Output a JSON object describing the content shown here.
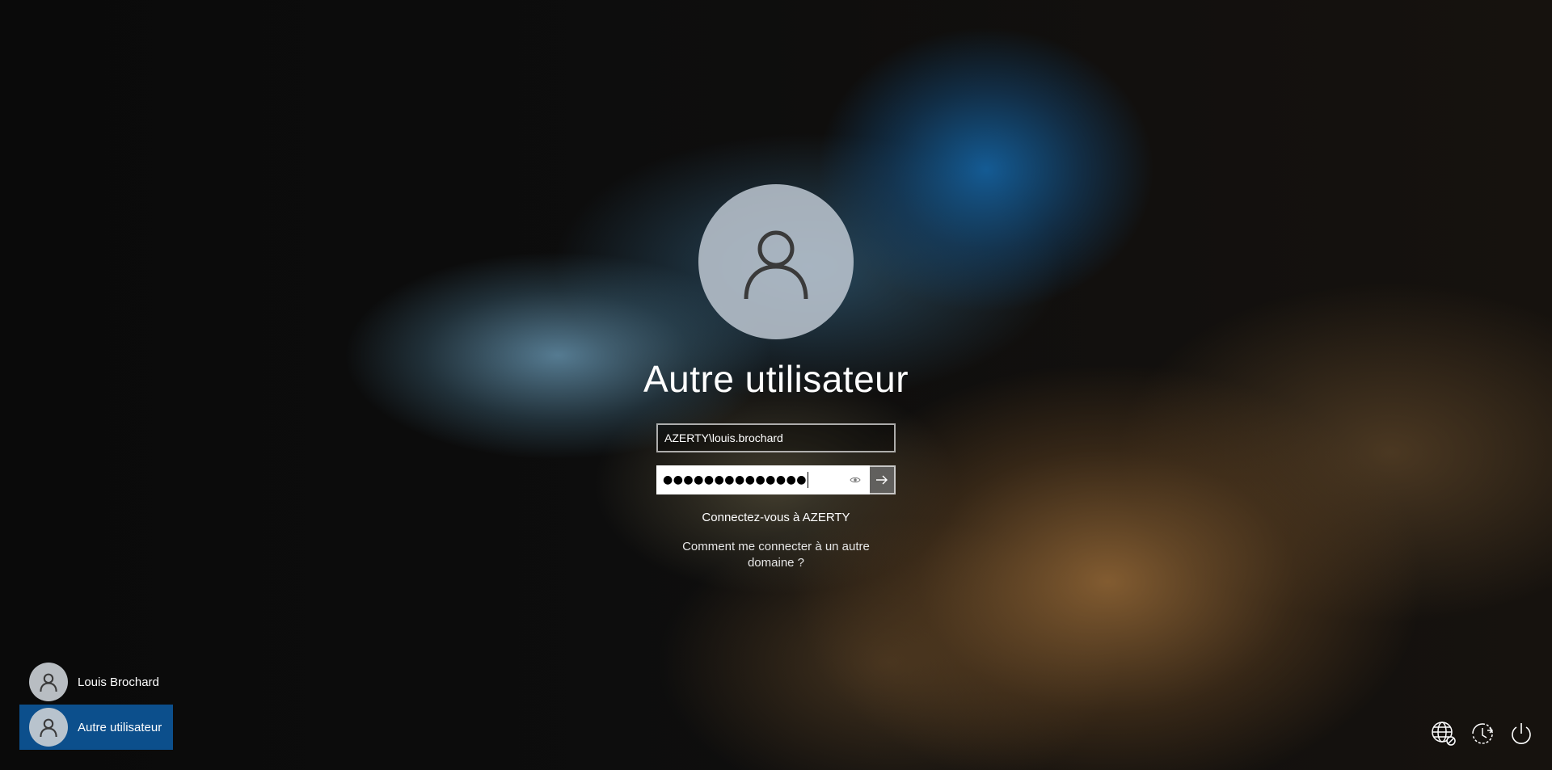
{
  "main_user": {
    "name": "Autre utilisateur",
    "avatar_icon": "user-silhouette-icon"
  },
  "username_field": {
    "value": "AZERTY\\louis.brochard"
  },
  "password_field": {
    "masked_value": "●●●●●●●●●●●●●●",
    "reveal_icon": "eye-icon"
  },
  "submit_button": {
    "icon": "arrow-right-icon"
  },
  "domain_text": "Connectez-vous à AZERTY",
  "other_domain_link": "Comment me connecter à un autre domaine ?",
  "user_list": {
    "items": [
      {
        "name": "Louis Brochard",
        "icon": "user-silhouette-icon",
        "selected": false
      },
      {
        "name": "Autre utilisateur",
        "icon": "user-silhouette-icon",
        "selected": true
      }
    ]
  },
  "system_buttons": {
    "network_icon": "network-globe-icon",
    "accessibility_icon": "ease-of-access-icon",
    "power_icon": "power-icon"
  },
  "colors": {
    "selected_user_bg": "#0c4f8c",
    "avatar_bg": "#bec8d2",
    "password_bg": "#ffffff"
  }
}
